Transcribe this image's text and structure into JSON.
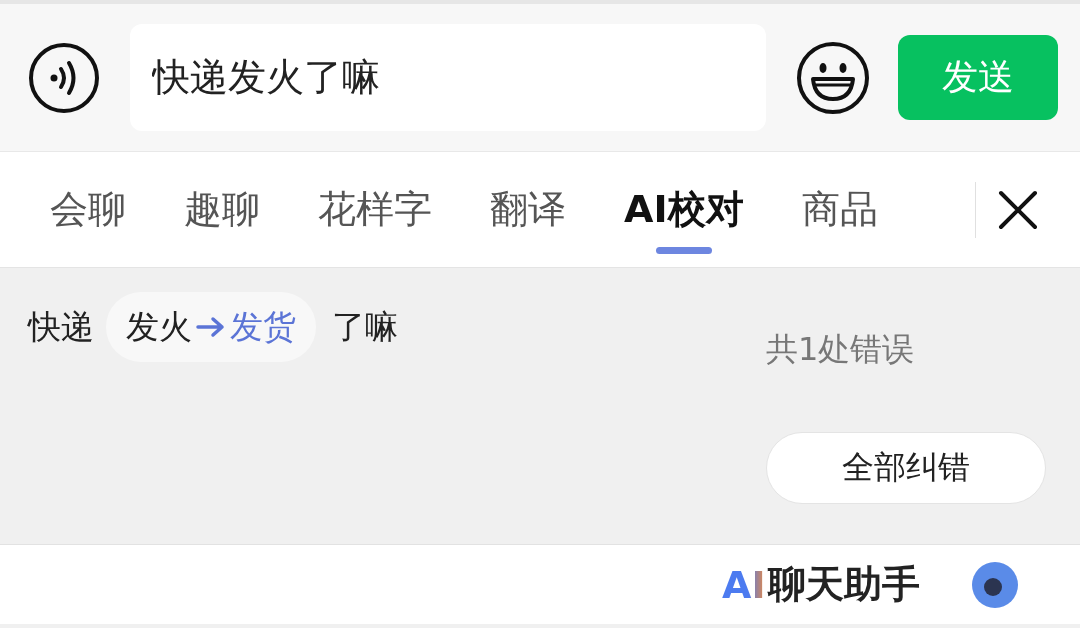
{
  "composer": {
    "value": "快递发火了嘛",
    "send_label": "发送"
  },
  "tabs": [
    {
      "label": "会聊",
      "selected": false
    },
    {
      "label": "趣聊",
      "selected": false
    },
    {
      "label": "花样字",
      "selected": false
    },
    {
      "label": "翻译",
      "selected": false
    },
    {
      "label": "AI校对",
      "selected": true
    },
    {
      "label": "商品",
      "selected": false
    }
  ],
  "correction": {
    "segments": [
      {
        "kind": "plain",
        "text": "快递"
      },
      {
        "kind": "fix",
        "original": "发火",
        "corrected": "发货"
      },
      {
        "kind": "plain",
        "text": "了嘛"
      }
    ],
    "error_count": "共1处错误",
    "fix_all_label": "全部纠错"
  },
  "footer": {
    "brand_mark": "AI",
    "brand_name": "聊天助手"
  }
}
